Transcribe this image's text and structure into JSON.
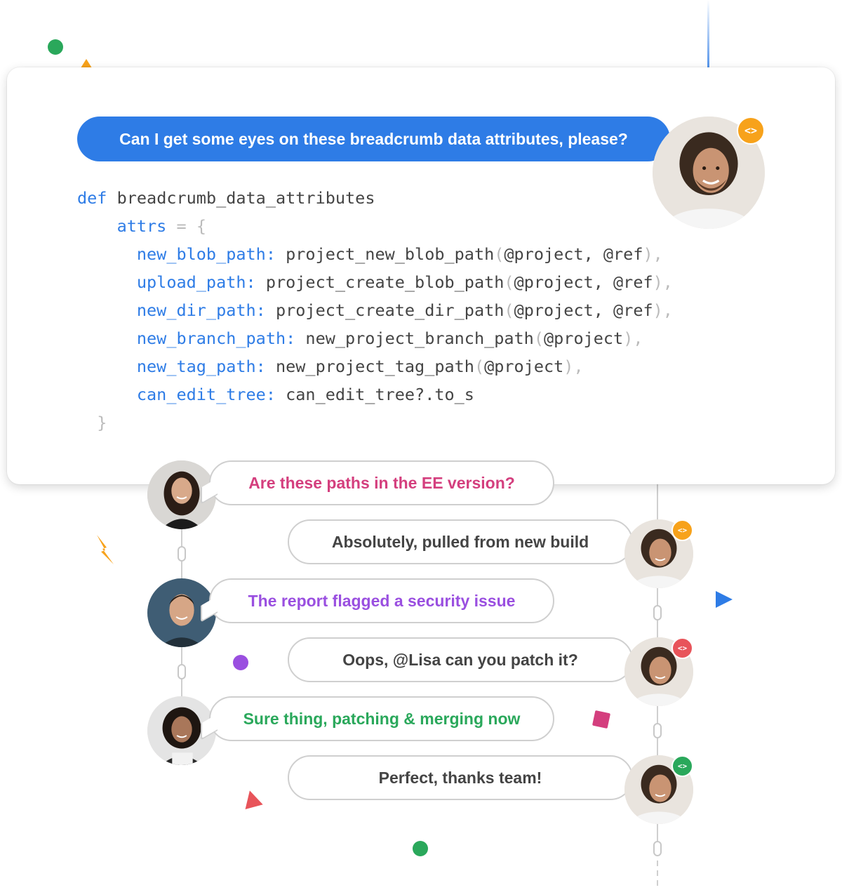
{
  "colors": {
    "blue": "#2e7ce6",
    "orange": "#f7a21b",
    "purple": "#9a4fe0",
    "green": "#2aa85b",
    "pink": "#d43f7e",
    "red": "#e8545a",
    "text_dark": "#444444",
    "bubble_border": "#cfcfcf"
  },
  "question": {
    "text": "Can I get some eyes on these breadcrumb data attributes, please?"
  },
  "code": {
    "keyword": "def",
    "method_name": "breadcrumb_data_attributes",
    "var_name": "attrs",
    "assign": "=",
    "open_brace": "{",
    "close_brace": "}",
    "lines": [
      {
        "key": "new_blob_path:",
        "call": "project_new_blob_path",
        "args": "@project, @ref"
      },
      {
        "key": "upload_path:",
        "call": "project_create_blob_path",
        "args": "@project, @ref"
      },
      {
        "key": "new_dir_path:",
        "call": "project_create_dir_path",
        "args": "@project, @ref"
      },
      {
        "key": "new_branch_path:",
        "call": "new_project_branch_path",
        "args": "@project"
      },
      {
        "key": "new_tag_path:",
        "call": "new_project_tag_path",
        "args": "@project"
      },
      {
        "key": "can_edit_tree:",
        "value": "can_edit_tree?.to_s"
      }
    ]
  },
  "badge_icon": "code-brackets-icon",
  "badge_text": "<>",
  "messages": [
    {
      "side": "left",
      "author": "woman-long-hair",
      "text": "Are these paths in the EE version?",
      "color": "#d43f7e"
    },
    {
      "side": "right",
      "author": "man-dreadlocks",
      "text": "Absolutely, pulled from new build",
      "color": "#444444",
      "badge_color": "#f7a21b"
    },
    {
      "side": "left",
      "author": "man-short-hair",
      "text": "The report flagged a security issue",
      "color": "#9a4fe0"
    },
    {
      "side": "right",
      "author": "man-dreadlocks",
      "text": "Oops,  @Lisa can you patch it?",
      "color": "#444444",
      "badge_color": "#e8545a"
    },
    {
      "side": "left",
      "author": "woman-curly-hair",
      "text": "Sure thing, patching & merging now",
      "color": "#2aa85b"
    },
    {
      "side": "right",
      "author": "man-dreadlocks",
      "text": "Perfect, thanks team!",
      "color": "#444444",
      "badge_color": "#2aa85b"
    }
  ]
}
